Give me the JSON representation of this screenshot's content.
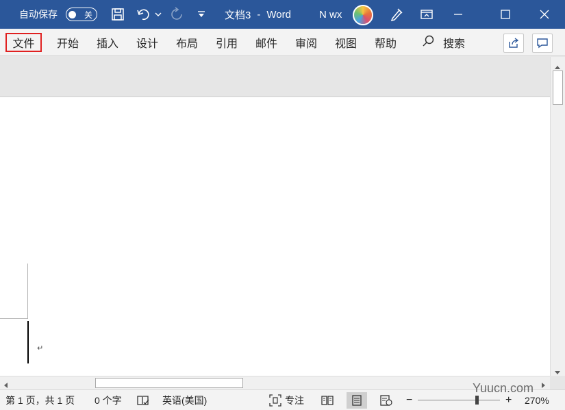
{
  "titlebar": {
    "autosave_label": "自动保存",
    "autosave_state": "关",
    "doc_name": "文档3",
    "separator": "-",
    "app_name": "Word",
    "user_name": "N wx",
    "bg_color": "#2b579a"
  },
  "ribbon": {
    "tabs": [
      {
        "label": "文件",
        "active": true
      },
      {
        "label": "开始"
      },
      {
        "label": "插入"
      },
      {
        "label": "设计"
      },
      {
        "label": "布局"
      },
      {
        "label": "引用"
      },
      {
        "label": "邮件"
      },
      {
        "label": "审阅"
      },
      {
        "label": "视图"
      },
      {
        "label": "帮助"
      }
    ],
    "search_label": "搜索"
  },
  "document": {
    "paragraph_mark": "↵"
  },
  "statusbar": {
    "page_info": "第 1 页，共 1 页",
    "word_count": "0 个字",
    "language": "英语(美国)",
    "focus_label": "专注",
    "zoom_level": "270%"
  },
  "watermark": "Yuucn.com"
}
